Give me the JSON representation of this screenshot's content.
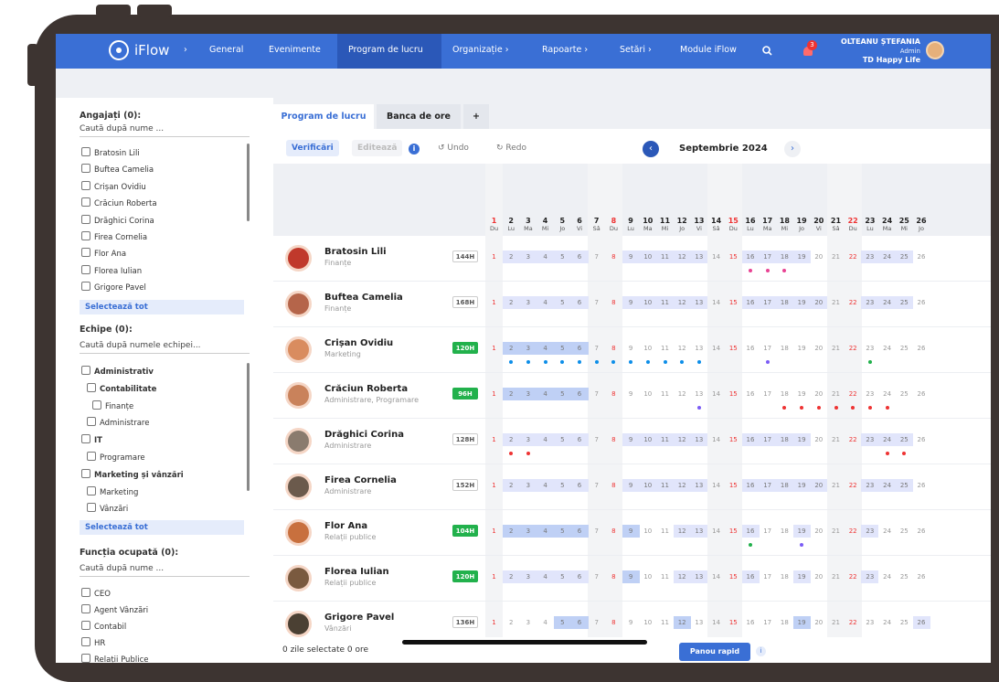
{
  "nav": {
    "brand": "iFlow",
    "sep": "›",
    "items": [
      "General",
      "Evenimente",
      "Program de lucru",
      "Organizație ›",
      "Rapoarte ›",
      "Setări ›",
      "Module iFlow"
    ],
    "active": "Program de lucru",
    "notif_count": "3",
    "user_name": "OLTEANU ȘTEFANIA",
    "user_role": "Admin",
    "user_company": "TD Happy Life",
    "icons": [
      "people-logo-icon",
      "search-icon",
      "bell-icon"
    ]
  },
  "left": {
    "employees_header": "Angajați (0):",
    "employees_search": "Caută după nume ...",
    "employees": [
      "Bratosin Lili",
      "Buftea Camelia",
      "Crișan Ovidiu",
      "Crăciun Roberta",
      "Drăghici Corina",
      "Firea Cornelia",
      "Flor Ana",
      "Florea Iulian",
      "Grigore Pavel"
    ],
    "select_all": "Selectează tot",
    "teams_header": "Echipe (0):",
    "teams_search": "Caută după numele echipei...",
    "teams": [
      "Administrativ",
      "Contabilitate",
      "Finanțe",
      "Administrare",
      "IT",
      "Programare",
      "Marketing și vânzări",
      "Marketing",
      "Vânzări"
    ],
    "functions_header": "Funcția ocupată (0):",
    "functions_search": "Caută după nume ...",
    "functions": [
      "CEO",
      "Agent Vânzări",
      "Contabil",
      "HR",
      "Relații Publice"
    ]
  },
  "main": {
    "tabs": [
      "Program de lucru",
      "Banca de ore",
      "+"
    ],
    "toolbar": {
      "verify": "Verificări",
      "edit": "Editează",
      "undo": "Undo",
      "redo": "Redo",
      "month": "Septembrie 2024"
    },
    "days": [
      {
        "d": "1",
        "w": "Du"
      },
      {
        "d": "2",
        "w": "Lu"
      },
      {
        "d": "3",
        "w": "Ma"
      },
      {
        "d": "4",
        "w": "Mi"
      },
      {
        "d": "5",
        "w": "Jo"
      },
      {
        "d": "6",
        "w": "Vi"
      },
      {
        "d": "7",
        "w": "Sâ"
      },
      {
        "d": "8",
        "w": "Du"
      },
      {
        "d": "9",
        "w": "Lu"
      },
      {
        "d": "10",
        "w": "Ma"
      },
      {
        "d": "11",
        "w": "Mi"
      },
      {
        "d": "12",
        "w": "Jo"
      },
      {
        "d": "13",
        "w": "Vi"
      },
      {
        "d": "14",
        "w": "Sâ"
      },
      {
        "d": "15",
        "w": "Du"
      },
      {
        "d": "16",
        "w": "Lu"
      },
      {
        "d": "17",
        "w": "Ma"
      },
      {
        "d": "18",
        "w": "Mi"
      },
      {
        "d": "19",
        "w": "Jo"
      },
      {
        "d": "20",
        "w": "Vi"
      },
      {
        "d": "21",
        "w": "Sâ"
      },
      {
        "d": "22",
        "w": "Du"
      },
      {
        "d": "23",
        "w": "Lu"
      },
      {
        "d": "24",
        "w": "Ma"
      },
      {
        "d": "25",
        "w": "Mi"
      },
      {
        "d": "26",
        "w": "Jo"
      }
    ],
    "rows": [
      {
        "name": "Bratosin Lili",
        "dept": "Finanțe",
        "hours": "144H",
        "green": false,
        "color": "#c0392b"
      },
      {
        "name": "Buftea Camelia",
        "dept": "Finanțe",
        "hours": "168H",
        "green": false,
        "color": "#b5654a"
      },
      {
        "name": "Crișan Ovidiu",
        "dept": "Marketing",
        "hours": "120H",
        "green": true,
        "color": "#d98c5f"
      },
      {
        "name": "Crăciun Roberta",
        "dept": "Administrare, Programare",
        "hours": "96H",
        "green": true,
        "color": "#c9825b"
      },
      {
        "name": "Drăghici Corina",
        "dept": "Administrare",
        "hours": "128H",
        "green": false,
        "color": "#8a7b6e"
      },
      {
        "name": "Firea Cornelia",
        "dept": "Administrare",
        "hours": "152H",
        "green": false,
        "color": "#6b5a4c"
      },
      {
        "name": "Flor Ana",
        "dept": "Relații publice",
        "hours": "104H",
        "green": true,
        "color": "#c8703e"
      },
      {
        "name": "Florea Iulian",
        "dept": "Relații publice",
        "hours": "120H",
        "green": true,
        "color": "#7a5a3f"
      },
      {
        "name": "Grigore Pavel",
        "dept": "Vânzări",
        "hours": "136H",
        "green": false,
        "color": "#4b4033"
      }
    ],
    "footer": {
      "selected": "0 zile selectate 0 ore",
      "quick": "Panou rapid"
    }
  }
}
